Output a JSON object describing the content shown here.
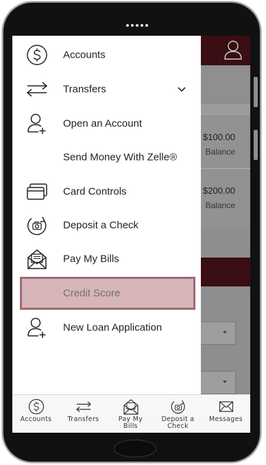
{
  "side_menu": {
    "items": [
      {
        "label": "Accounts",
        "icon": "dollar-circle-icon"
      },
      {
        "label": "Transfers",
        "icon": "transfer-arrows-icon",
        "expandable": true
      },
      {
        "label": "Open an Account",
        "icon": "add-user-icon"
      },
      {
        "label": "Send Money With Zelle®",
        "icon": ""
      },
      {
        "label": "Card Controls",
        "icon": "cards-icon"
      },
      {
        "label": "Deposit a Check",
        "icon": "deposit-camera-icon"
      },
      {
        "label": "Pay My Bills",
        "icon": "bill-envelope-icon"
      },
      {
        "label": "Credit Score",
        "icon": "",
        "selected": true
      },
      {
        "label": "New Loan Application",
        "icon": "add-user-icon"
      }
    ]
  },
  "background": {
    "accounts": [
      {
        "amount": "$100.00",
        "caption": "Balance"
      },
      {
        "amount": "$200.00",
        "caption": "Balance"
      }
    ]
  },
  "tab_bar": {
    "tabs": [
      {
        "label": "Accounts",
        "icon": "dollar-circle-icon"
      },
      {
        "label": "Transfers",
        "icon": "transfer-arrows-icon"
      },
      {
        "label": "Pay My Bills",
        "icon": "bill-envelope-icon"
      },
      {
        "label": "Deposit a Check",
        "icon": "deposit-camera-icon"
      },
      {
        "label": "Messages",
        "icon": "envelope-icon"
      }
    ]
  },
  "colors": {
    "brand_dark": "#3a0e12",
    "selected_fill": "#d7b5b9",
    "selected_border": "#9b6b72",
    "overlay_gray": "#8e8e8e"
  }
}
